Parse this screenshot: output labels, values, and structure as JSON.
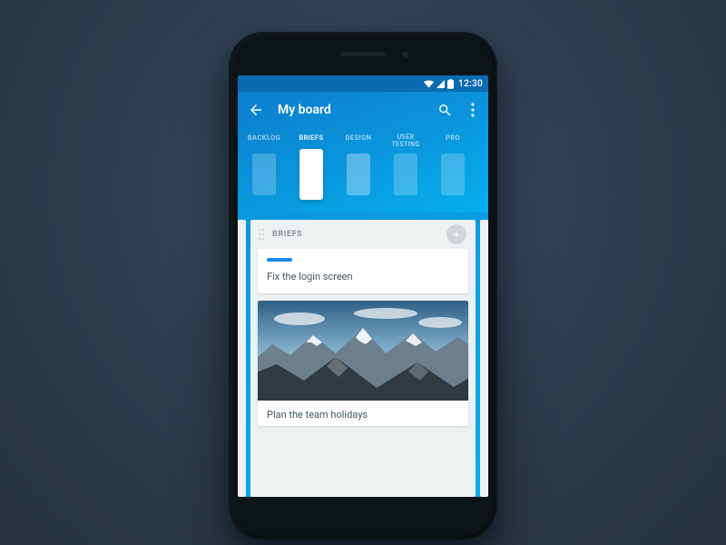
{
  "status": {
    "time": "12:30"
  },
  "appbar": {
    "title": "My board"
  },
  "tabs": [
    {
      "id": "backlog",
      "label": "BACKLOG"
    },
    {
      "id": "briefs",
      "label": "BRIEFS",
      "active": true
    },
    {
      "id": "design",
      "label": "DESIGN"
    },
    {
      "id": "user-testing",
      "label": "USER\nTESTING"
    },
    {
      "id": "pro",
      "label": "PRO"
    }
  ],
  "list": {
    "title": "BRIEFS",
    "cards": [
      {
        "title": "Fix the login screen",
        "label_color": "#1e88e5"
      },
      {
        "title": "Plan the team holidays",
        "has_cover": true
      }
    ]
  }
}
